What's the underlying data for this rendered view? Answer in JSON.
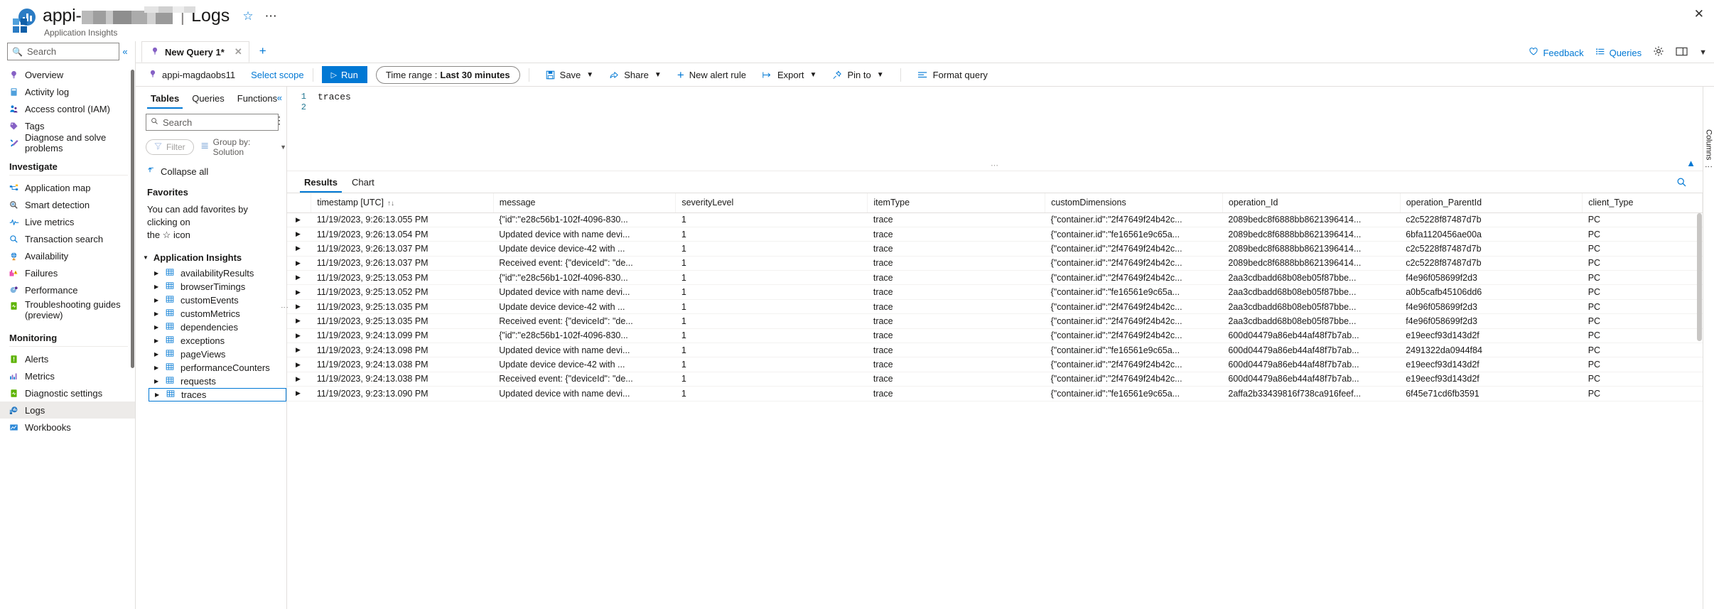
{
  "header": {
    "resource_name": "appi-",
    "section": "Logs",
    "separator": "|",
    "subtitle": "Application Insights",
    "favorite_icon": "star-icon",
    "more_icon": "ellipsis-icon",
    "close_icon": "close-icon"
  },
  "sidebar": {
    "search_placeholder": "Search",
    "collapse_icon": "chevron-double-left-icon",
    "items": [
      {
        "label": "Overview",
        "icon": "lightbulb-icon",
        "selected": false
      },
      {
        "label": "Activity log",
        "icon": "activity-log-icon",
        "selected": false
      },
      {
        "label": "Access control (IAM)",
        "icon": "people-icon",
        "selected": false
      },
      {
        "label": "Tags",
        "icon": "tag-icon",
        "selected": false
      },
      {
        "label": "Diagnose and solve problems",
        "icon": "wrench-icon",
        "selected": false
      }
    ],
    "groups": [
      {
        "title": "Investigate",
        "items": [
          {
            "label": "Application map",
            "icon": "app-map-icon",
            "selected": false
          },
          {
            "label": "Smart detection",
            "icon": "smart-detection-icon",
            "selected": false
          },
          {
            "label": "Live metrics",
            "icon": "pulse-icon",
            "selected": false
          },
          {
            "label": "Transaction search",
            "icon": "magnifier-icon",
            "selected": false
          },
          {
            "label": "Availability",
            "icon": "globe-icon",
            "selected": false
          },
          {
            "label": "Failures",
            "icon": "failures-chart-icon",
            "selected": false
          },
          {
            "label": "Performance",
            "icon": "performance-icon",
            "selected": false
          },
          {
            "label": "Troubleshooting guides (preview)",
            "icon": "guides-icon",
            "selected": false
          }
        ]
      },
      {
        "title": "Monitoring",
        "items": [
          {
            "label": "Alerts",
            "icon": "alert-icon",
            "selected": false
          },
          {
            "label": "Metrics",
            "icon": "metrics-icon",
            "selected": false
          },
          {
            "label": "Diagnostic settings",
            "icon": "diagnostic-settings-icon",
            "selected": false
          },
          {
            "label": "Logs",
            "icon": "logs-icon",
            "selected": true
          },
          {
            "label": "Workbooks",
            "icon": "workbooks-icon",
            "selected": false
          }
        ]
      }
    ]
  },
  "query_tabs": {
    "tabs": [
      {
        "label": "New Query 1*",
        "icon": "lightbulb-icon",
        "close_icon": "close-icon",
        "active": true
      }
    ],
    "add_icon": "plus-icon"
  },
  "top_right": {
    "feedback": "Feedback",
    "feedback_icon": "heart-icon",
    "queries": "Queries",
    "queries_icon": "list-icon",
    "settings_icon": "gear-icon",
    "layout_icon": "layout-icon",
    "chevron_icon": "chevron-down-icon"
  },
  "toolbar": {
    "scope_name": "appi-magdaobs11",
    "scope_icon": "lightbulb-icon",
    "select_scope": "Select scope",
    "run_label": "Run",
    "run_icon": "play-icon",
    "run_color": "#0078d4",
    "time_range_label": "Time range :",
    "time_range_value": "Last 30 minutes",
    "buttons": [
      {
        "label": "Save",
        "icon": "save-icon",
        "caret": true
      },
      {
        "label": "Share",
        "icon": "share-icon",
        "caret": true
      },
      {
        "label": "New alert rule",
        "icon": "plus-icon",
        "caret": false
      },
      {
        "label": "Export",
        "icon": "export-icon",
        "caret": true
      },
      {
        "label": "Pin to",
        "icon": "pin-icon",
        "caret": true
      },
      {
        "label": "Format query",
        "icon": "format-icon",
        "caret": false
      }
    ]
  },
  "tables_panel": {
    "tabs": [
      {
        "label": "Tables",
        "active": true
      },
      {
        "label": "Queries",
        "active": false
      },
      {
        "label": "Functions",
        "active": false
      }
    ],
    "more_icon": "ellipsis-icon",
    "collapse_icon": "chevron-double-left-icon",
    "search_placeholder": "Search",
    "kebab_icon": "ellipsis-vertical-icon",
    "filter_label": "Filter",
    "filter_icon": "funnel-icon",
    "group_by_label": "Group by: Solution",
    "group_by_icon": "group-icon",
    "collapse_all_label": "Collapse all",
    "collapse_all_icon": "collapse-all-icon",
    "favorites_title": "Favorites",
    "favorites_text_line1": "You can add favorites by clicking on",
    "favorites_text_line2": "the ☆ icon",
    "group_title": "Application Insights",
    "tables": [
      {
        "name": "availabilityResults",
        "selected": false
      },
      {
        "name": "browserTimings",
        "selected": false
      },
      {
        "name": "customEvents",
        "selected": false
      },
      {
        "name": "customMetrics",
        "selected": false
      },
      {
        "name": "dependencies",
        "selected": false
      },
      {
        "name": "exceptions",
        "selected": false
      },
      {
        "name": "pageViews",
        "selected": false
      },
      {
        "name": "performanceCounters",
        "selected": false
      },
      {
        "name": "requests",
        "selected": false
      },
      {
        "name": "traces",
        "selected": true
      }
    ]
  },
  "editor": {
    "lines": [
      "traces",
      ""
    ],
    "line_numbers": [
      "1",
      "2"
    ],
    "collapse_icon": "chevron-double-up-icon",
    "drag_handle_icon": "drag-dots-icon"
  },
  "results": {
    "tabs": [
      {
        "label": "Results",
        "active": true
      },
      {
        "label": "Chart",
        "active": false
      }
    ],
    "search_icon": "magnifier-icon",
    "columns_rail_label": "Columns",
    "columns": [
      {
        "key": "timestamp",
        "label": "timestamp [UTC]",
        "sortable": true,
        "sort_icon": "sort-updown-icon"
      },
      {
        "key": "message",
        "label": "message",
        "sortable": false
      },
      {
        "key": "severityLevel",
        "label": "severityLevel",
        "sortable": false
      },
      {
        "key": "itemType",
        "label": "itemType",
        "sortable": false
      },
      {
        "key": "customDimensions",
        "label": "customDimensions",
        "sortable": false
      },
      {
        "key": "operation_Id",
        "label": "operation_Id",
        "sortable": false
      },
      {
        "key": "operation_ParentId",
        "label": "operation_ParentId",
        "sortable": false
      },
      {
        "key": "client_Type",
        "label": "client_Type",
        "sortable": false
      }
    ],
    "rows": [
      {
        "timestamp": "11/19/2023, 9:26:13.055 PM",
        "message": "{\"id\":\"e28c56b1-102f-4096-830...",
        "severityLevel": "1",
        "itemType": "trace",
        "customDimensions": "{\"container.id\":\"2f47649f24b42c...",
        "operation_Id": "2089bedc8f6888bb8621396414...",
        "operation_ParentId": "c2c5228f87487d7b",
        "client_Type": "PC"
      },
      {
        "timestamp": "11/19/2023, 9:26:13.054 PM",
        "message": "Updated device with name devi...",
        "severityLevel": "1",
        "itemType": "trace",
        "customDimensions": "{\"container.id\":\"fe16561e9c65a...",
        "operation_Id": "2089bedc8f6888bb8621396414...",
        "operation_ParentId": "6bfa1120456ae00a",
        "client_Type": "PC"
      },
      {
        "timestamp": "11/19/2023, 9:26:13.037 PM",
        "message": "Update device device-42 with ...",
        "severityLevel": "1",
        "itemType": "trace",
        "customDimensions": "{\"container.id\":\"2f47649f24b42c...",
        "operation_Id": "2089bedc8f6888bb8621396414...",
        "operation_ParentId": "c2c5228f87487d7b",
        "client_Type": "PC"
      },
      {
        "timestamp": "11/19/2023, 9:26:13.037 PM",
        "message": "Received event: {\"deviceId\": \"de...",
        "severityLevel": "1",
        "itemType": "trace",
        "customDimensions": "{\"container.id\":\"2f47649f24b42c...",
        "operation_Id": "2089bedc8f6888bb8621396414...",
        "operation_ParentId": "c2c5228f87487d7b",
        "client_Type": "PC"
      },
      {
        "timestamp": "11/19/2023, 9:25:13.053 PM",
        "message": "{\"id\":\"e28c56b1-102f-4096-830...",
        "severityLevel": "1",
        "itemType": "trace",
        "customDimensions": "{\"container.id\":\"2f47649f24b42c...",
        "operation_Id": "2aa3cdbadd68b08eb05f87bbe...",
        "operation_ParentId": "f4e96f058699f2d3",
        "client_Type": "PC"
      },
      {
        "timestamp": "11/19/2023, 9:25:13.052 PM",
        "message": "Updated device with name devi...",
        "severityLevel": "1",
        "itemType": "trace",
        "customDimensions": "{\"container.id\":\"fe16561e9c65a...",
        "operation_Id": "2aa3cdbadd68b08eb05f87bbe...",
        "operation_ParentId": "a0b5cafb45106dd6",
        "client_Type": "PC"
      },
      {
        "timestamp": "11/19/2023, 9:25:13.035 PM",
        "message": "Update device device-42 with ...",
        "severityLevel": "1",
        "itemType": "trace",
        "customDimensions": "{\"container.id\":\"2f47649f24b42c...",
        "operation_Id": "2aa3cdbadd68b08eb05f87bbe...",
        "operation_ParentId": "f4e96f058699f2d3",
        "client_Type": "PC"
      },
      {
        "timestamp": "11/19/2023, 9:25:13.035 PM",
        "message": "Received event: {\"deviceId\": \"de...",
        "severityLevel": "1",
        "itemType": "trace",
        "customDimensions": "{\"container.id\":\"2f47649f24b42c...",
        "operation_Id": "2aa3cdbadd68b08eb05f87bbe...",
        "operation_ParentId": "f4e96f058699f2d3",
        "client_Type": "PC"
      },
      {
        "timestamp": "11/19/2023, 9:24:13.099 PM",
        "message": "{\"id\":\"e28c56b1-102f-4096-830...",
        "severityLevel": "1",
        "itemType": "trace",
        "customDimensions": "{\"container.id\":\"2f47649f24b42c...",
        "operation_Id": "600d04479a86eb44af48f7b7ab...",
        "operation_ParentId": "e19eecf93d143d2f",
        "client_Type": "PC"
      },
      {
        "timestamp": "11/19/2023, 9:24:13.098 PM",
        "message": "Updated device with name devi...",
        "severityLevel": "1",
        "itemType": "trace",
        "customDimensions": "{\"container.id\":\"fe16561e9c65a...",
        "operation_Id": "600d04479a86eb44af48f7b7ab...",
        "operation_ParentId": "2491322da0944f84",
        "client_Type": "PC"
      },
      {
        "timestamp": "11/19/2023, 9:24:13.038 PM",
        "message": "Update device device-42 with ...",
        "severityLevel": "1",
        "itemType": "trace",
        "customDimensions": "{\"container.id\":\"2f47649f24b42c...",
        "operation_Id": "600d04479a86eb44af48f7b7ab...",
        "operation_ParentId": "e19eecf93d143d2f",
        "client_Type": "PC"
      },
      {
        "timestamp": "11/19/2023, 9:24:13.038 PM",
        "message": "Received event: {\"deviceId\": \"de...",
        "severityLevel": "1",
        "itemType": "trace",
        "customDimensions": "{\"container.id\":\"2f47649f24b42c...",
        "operation_Id": "600d04479a86eb44af48f7b7ab...",
        "operation_ParentId": "e19eecf93d143d2f",
        "client_Type": "PC"
      },
      {
        "timestamp": "11/19/2023, 9:23:13.090 PM",
        "message": "Updated device with name devi...",
        "severityLevel": "1",
        "itemType": "trace",
        "customDimensions": "{\"container.id\":\"fe16561e9c65a...",
        "operation_Id": "2affa2b33439816f738ca916feef...",
        "operation_ParentId": "6f45e71cd6fb3591",
        "client_Type": "PC"
      }
    ]
  }
}
